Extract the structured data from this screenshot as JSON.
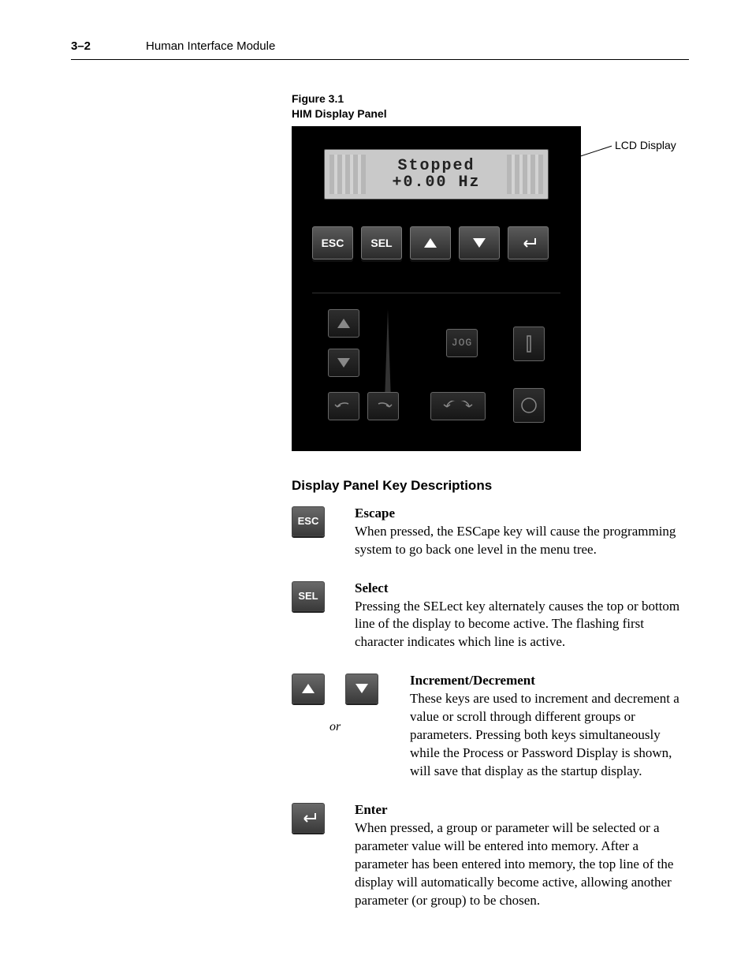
{
  "header": {
    "page_number": "3–2",
    "chapter": "Human Interface Module"
  },
  "figure": {
    "number": "Figure 3.1",
    "title": "HIM Display Panel",
    "lcd_line1": "Stopped",
    "lcd_line2": "+0.00 Hz",
    "callout": "LCD Display",
    "keys": {
      "esc": "ESC",
      "sel": "SEL",
      "jog": "JOG"
    }
  },
  "section_heading": "Display Panel Key Descriptions",
  "or_label": "or",
  "descriptions": {
    "escape": {
      "title": "Escape",
      "body": "When pressed, the ESCape key will cause the programming system to go back one level in the menu tree."
    },
    "select": {
      "title": "Select",
      "body": "Pressing the SELect key alternately causes the top or bottom line of the display to become active. The flashing first character indicates which line is active."
    },
    "incdec": {
      "title": "Increment/Decrement",
      "body": "These keys are used to increment and decrement a value or scroll through different groups or parameters. Pressing both keys simultaneously while the Process or Password Display is shown, will save that display as the startup display."
    },
    "enter": {
      "title": "Enter",
      "body": "When pressed, a group or parameter will be selected or a parameter value will be entered into memory. After a parameter has been entered into memory, the top line of the display will automatically become active, allowing another parameter (or group) to be chosen."
    }
  },
  "icon_labels": {
    "esc": "ESC",
    "sel": "SEL"
  }
}
